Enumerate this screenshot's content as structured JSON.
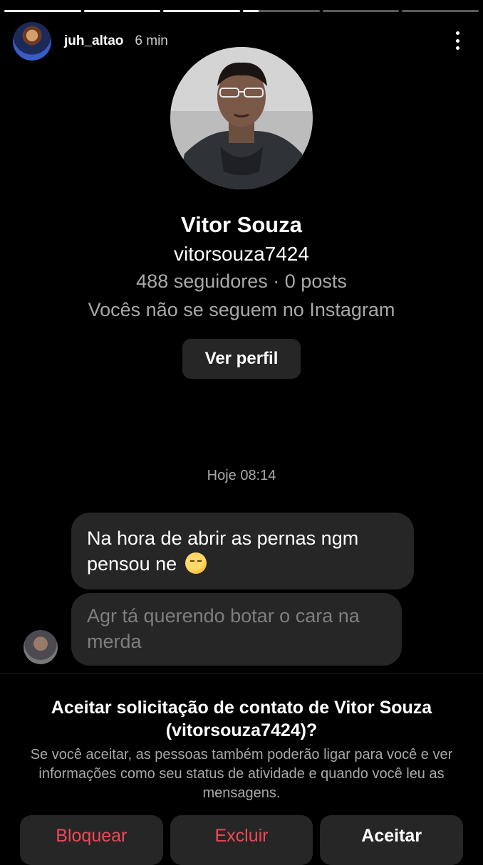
{
  "story": {
    "progress": [
      1,
      1,
      1,
      0.2,
      0,
      0
    ],
    "username": "juh_altao",
    "time": "6 min",
    "avatar_icon": "user-avatar",
    "menu_icon": "more-vertical-icon"
  },
  "profile": {
    "name": "Vitor Souza",
    "username": "vitorsouza7424",
    "stats": "488 seguidores · 0 posts",
    "mutual": "Vocês não se seguem no Instagram",
    "view_profile_label": "Ver perfil"
  },
  "messages": {
    "timestamp": "Hoje 08:14",
    "items": [
      {
        "text": "Na hora de abrir as pernas ngm pensou ne",
        "emoji": "tired-face-emoji"
      },
      {
        "text": "Agr tá querendo botar o cara na merda"
      }
    ]
  },
  "request": {
    "title": "Aceitar solicitação de contato de Vitor Souza (vitorsouza7424)?",
    "body": "Se você aceitar, as pessoas também poderão ligar para você e ver informações como seu status de atividade e quando você leu as mensagens.",
    "block_label": "Bloquear",
    "delete_label": "Excluir",
    "accept_label": "Aceitar"
  },
  "colors": {
    "background": "#000000",
    "bubble": "#262626",
    "secondary_text": "#a8a8a8",
    "danger": "#ed4956"
  }
}
